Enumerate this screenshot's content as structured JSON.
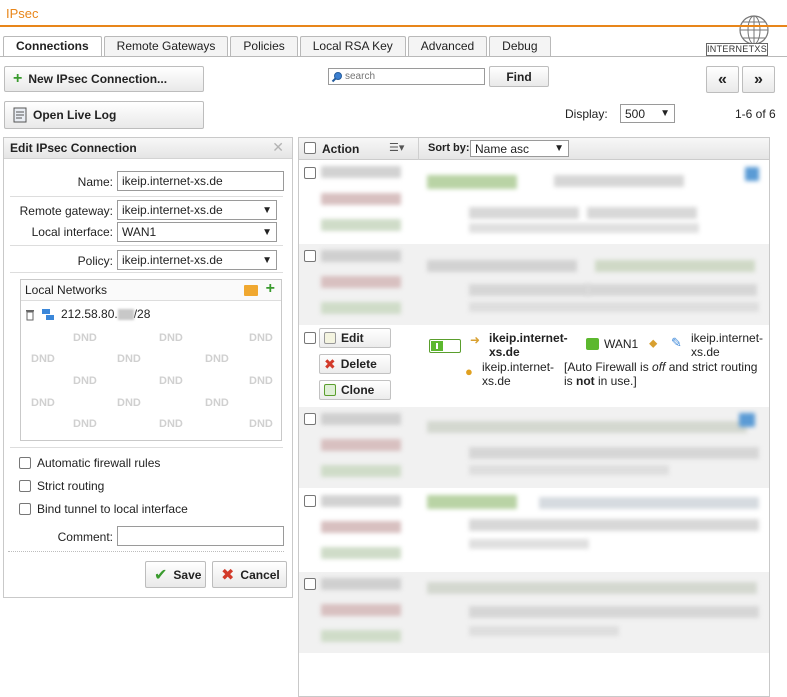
{
  "header": {
    "title": "IPsec",
    "logo_text": "INTERNETXS"
  },
  "tabs": [
    {
      "label": "Connections",
      "active": true
    },
    {
      "label": "Remote Gateways",
      "active": false
    },
    {
      "label": "Policies",
      "active": false
    },
    {
      "label": "Local RSA Key",
      "active": false
    },
    {
      "label": "Advanced",
      "active": false
    },
    {
      "label": "Debug",
      "active": false
    }
  ],
  "toolbar": {
    "new_connection": "New IPsec Connection...",
    "open_live_log": "Open Live Log",
    "search_placeholder": "search",
    "find": "Find",
    "prev": "«",
    "next": "»",
    "display_label": "Display:",
    "display_value": "500",
    "count": "1-6 of 6"
  },
  "edit_panel": {
    "title": "Edit IPsec Connection",
    "name_label": "Name:",
    "name_value": "ikeip.internet-xs.de",
    "remote_gateway_label": "Remote gateway:",
    "remote_gateway_value": "ikeip.internet-xs.de",
    "local_interface_label": "Local interface:",
    "local_interface_value": "WAN1",
    "policy_label": "Policy:",
    "policy_value": "ikeip.internet-xs.de",
    "local_networks_label": "Local Networks",
    "network_entry": "212.58.80.",
    "network_suffix": "/28",
    "dnd": "DND",
    "auto_firewall": "Automatic firewall rules",
    "strict_routing": "Strict routing",
    "bind_tunnel": "Bind tunnel to local interface",
    "comment_label": "Comment:",
    "comment_value": "",
    "save": "Save",
    "cancel": "Cancel"
  },
  "table": {
    "action_label": "Action",
    "sort_by_label": "Sort by:",
    "sort_value": "Name asc",
    "active_row": {
      "edit": "Edit",
      "delete": "Delete",
      "clone": "Clone",
      "remote_gateway_line1": "ikeip.internet-",
      "remote_gateway_line2": "xs.de",
      "interface": "WAN1",
      "policy_line1": "ikeip.internet-",
      "policy_line2": "xs.de",
      "network_line1": "ikeip.internet-",
      "network_line2": "xs.de",
      "note_pre": "[Auto Firewall is ",
      "note_off": "off",
      "note_mid": " and strict routing",
      "note_pre2": "is ",
      "note_not": "not",
      "note_post": " in use.]"
    }
  },
  "colors": {
    "accent": "#e8861a",
    "green": "#3a9b2e",
    "red": "#d23a2a"
  }
}
